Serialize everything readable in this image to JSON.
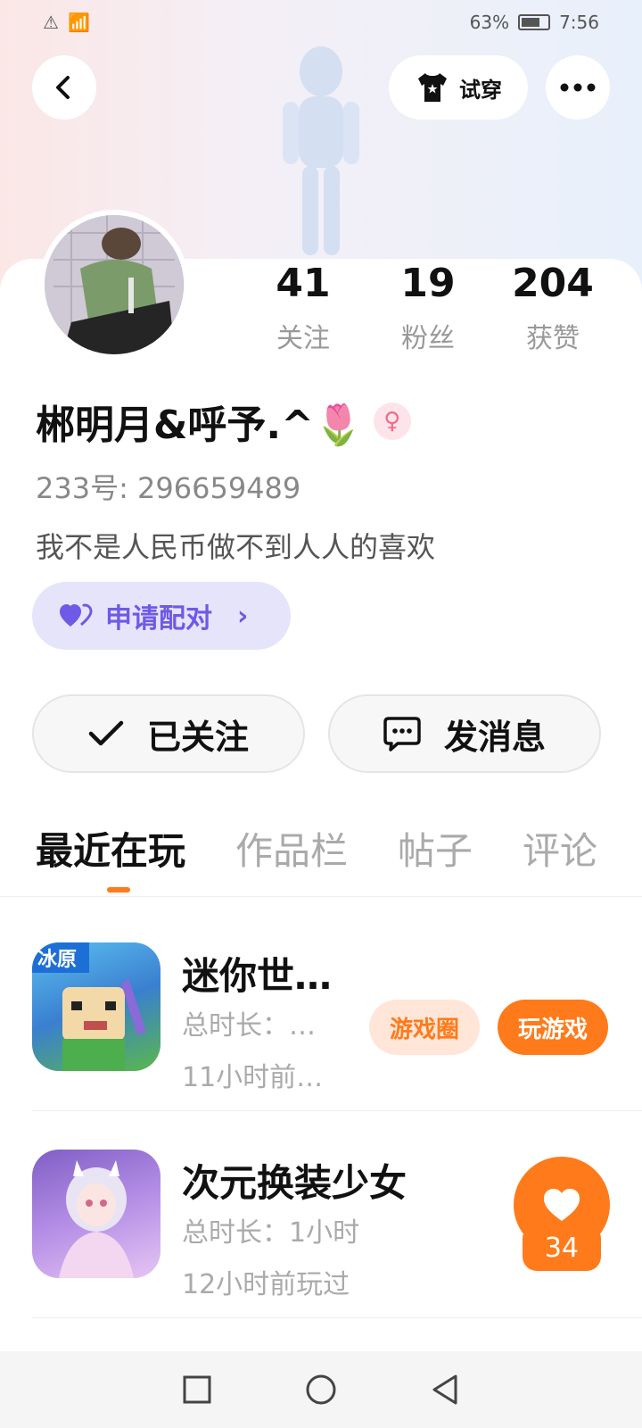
{
  "status_bar": {
    "battery_percent": "63%",
    "time": "7:56"
  },
  "header": {
    "try_on_label": "试穿"
  },
  "profile": {
    "stats": [
      {
        "value": "41",
        "label": "关注"
      },
      {
        "value": "19",
        "label": "粉丝"
      },
      {
        "value": "204",
        "label": "获赞"
      }
    ],
    "username": "郴明月&呼予.^🌷",
    "gender_symbol": "♀",
    "uid": "233号: 296659489",
    "bio": "我不是人民币做不到人人的喜欢",
    "pair_label": "申请配对"
  },
  "actions": {
    "followed_label": "已关注",
    "message_label": "发消息"
  },
  "tabs": [
    {
      "label": "最近在玩"
    },
    {
      "label": "作品栏"
    },
    {
      "label": "帖子"
    },
    {
      "label": "评论"
    }
  ],
  "games": [
    {
      "name": "迷你世…",
      "duration": "总时长：…",
      "last_played": "11小时前…",
      "circle_label": "游戏圈",
      "play_label": "玩游戏",
      "icon_text": "冰原"
    },
    {
      "name": "次元换装少女",
      "duration": "总时长：1小时",
      "last_played": "12小时前玩过"
    }
  ],
  "like_count": "34",
  "colors": {
    "accent": "#ff7a1a",
    "pair_purple": "#6e5ae6"
  }
}
